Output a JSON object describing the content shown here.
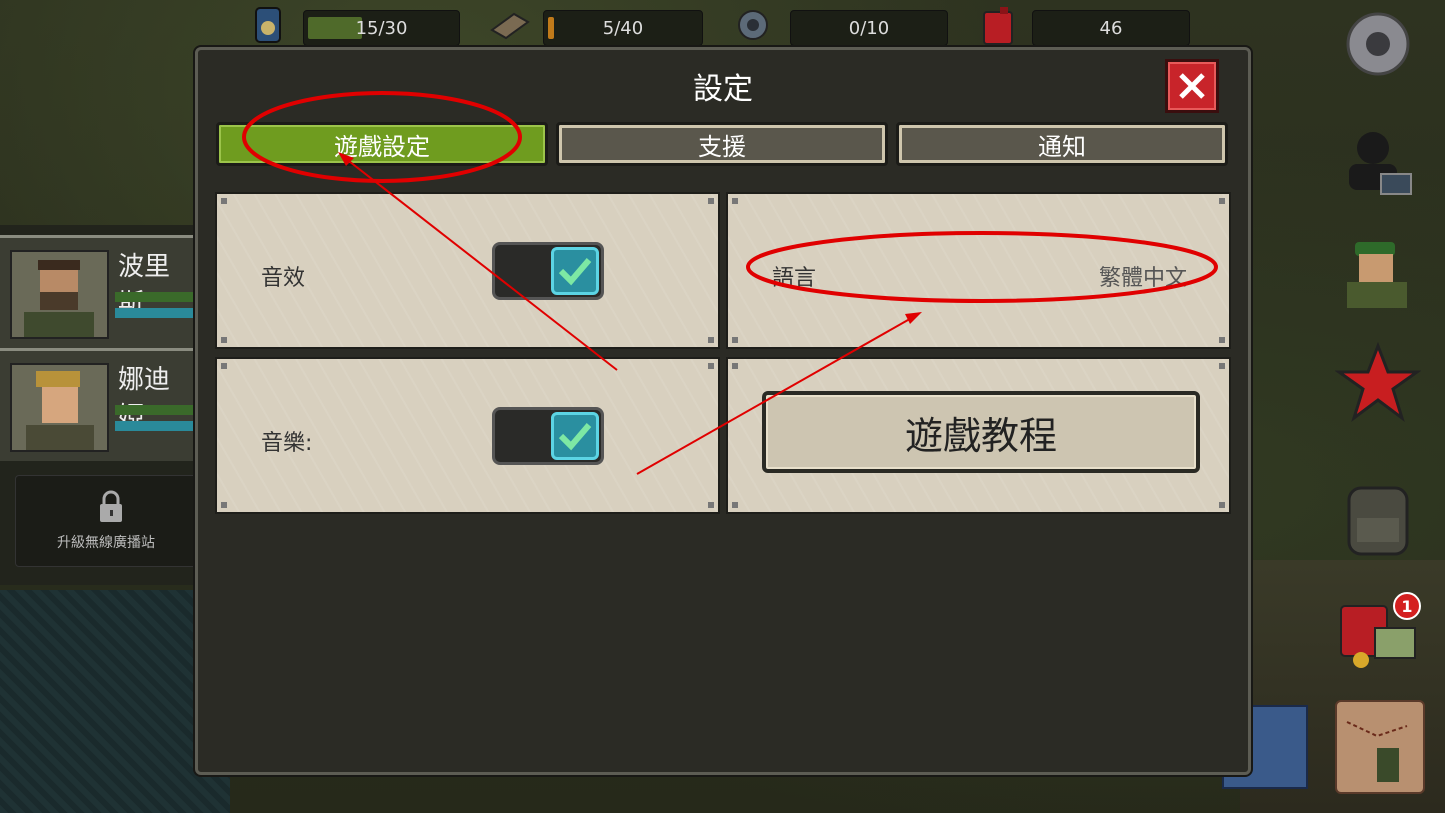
{
  "resources": [
    {
      "icon": "canned-food-icon",
      "value": "15/30",
      "fill": 0.5
    },
    {
      "icon": "wood-planks-icon",
      "value": "5/40",
      "fill": 0.125
    },
    {
      "icon": "gear-part-icon",
      "value": "0/10",
      "fill": 0
    },
    {
      "icon": "fuel-can-icon",
      "value": "46",
      "fill": 0
    }
  ],
  "roster": {
    "heroes": [
      {
        "name": "波里斯"
      },
      {
        "name": "娜迪婭"
      }
    ],
    "locked_label": "升級無線廣播站"
  },
  "side_icons": [
    "settings-gear-icon",
    "character-profile-icon",
    "soldier-icon",
    "red-star-icon",
    "backpack-icon",
    "supplies-icon",
    "map-icon"
  ],
  "side_badge": "1",
  "dialog": {
    "title": "設定",
    "tabs": [
      {
        "label": "遊戲設定",
        "active": true
      },
      {
        "label": "支援",
        "active": false
      },
      {
        "label": "通知",
        "active": false
      }
    ],
    "sound": {
      "label": "音效",
      "enabled": true
    },
    "music": {
      "label": "音樂:",
      "enabled": true
    },
    "language": {
      "label": "語言",
      "value": "繁體中文"
    },
    "tutorial_button": "遊戲教程"
  },
  "colors": {
    "annotation": "#e00000",
    "active_tab": "#6f9c1f",
    "toggle_on": "#2a8fa0",
    "close": "#c8242a"
  }
}
